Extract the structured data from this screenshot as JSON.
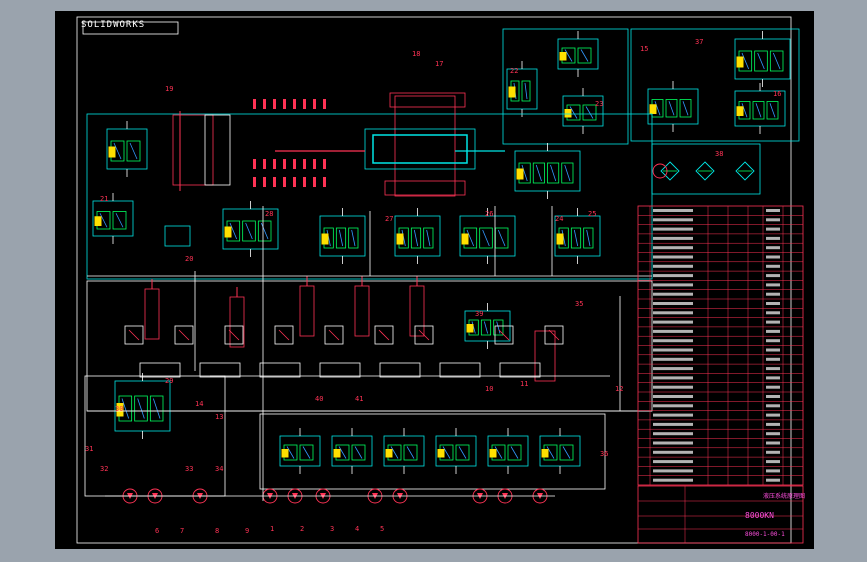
{
  "drawing": {
    "stamp": "SOLIDWORKS",
    "title_block": {
      "title": "8000KN",
      "drawing_no": "8000-1-00-1",
      "heading": "液压系统原理图"
    }
  },
  "colors": {
    "background": "#000000",
    "frame": "#ffffff",
    "component": "#00e5e5",
    "line": "#ffffff",
    "accent": "#ff3355",
    "label": "#ff4fe0",
    "valve": "#ffe000",
    "signal": "#00ff60",
    "port": "#3399ff"
  },
  "callouts": [
    "1",
    "2",
    "3",
    "4",
    "5",
    "6",
    "7",
    "8",
    "9",
    "10",
    "11",
    "12",
    "13",
    "14",
    "15",
    "16",
    "17",
    "18",
    "19",
    "20",
    "21",
    "22",
    "23",
    "24",
    "25",
    "26",
    "27",
    "28",
    "29",
    "30",
    "31",
    "32",
    "33",
    "34",
    "35",
    "36",
    "37",
    "38",
    "39",
    "40",
    "41"
  ],
  "parts_list_rows": 30
}
